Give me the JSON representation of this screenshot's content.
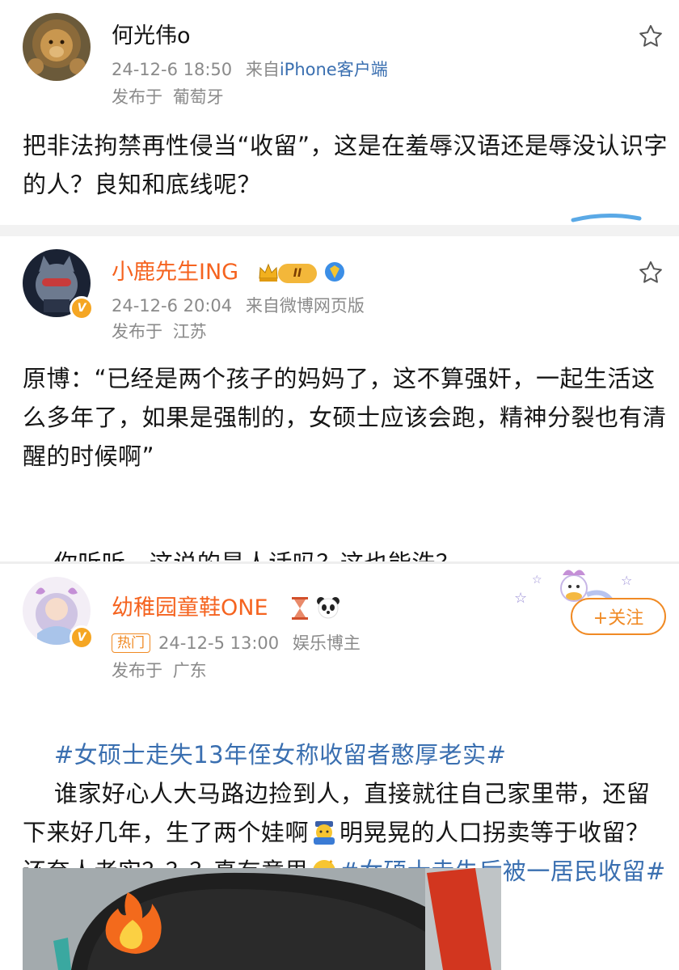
{
  "posts": [
    {
      "username": "何光伟o",
      "date": "24-12-6 18:50",
      "source_prefix": "来自",
      "source": "iPhone客户端",
      "location_label": "发布于",
      "location": "葡萄牙",
      "text": "把非法拘禁再性侵当“收留”，这是在羞辱汉语还是辱没认识字的人？良知和底线呢？"
    },
    {
      "username": "小鹿先生ING",
      "member_level": "II",
      "date": "24-12-6 20:04",
      "source_prefix": "来自",
      "source": "微博网页版",
      "location_label": "发布于",
      "location": "江苏",
      "text_line1": "原博：“已经是两个孩子的妈妈了，这不算强奸，一起生活这么多年了，如果是强制的，女硕士应该会跑，精神分裂也有清醒的时候啊”",
      "text_line2": "你听听，这说的是人话吗？这也能洗？"
    },
    {
      "username": "幼稚园童鞋ONE",
      "hot_tag": "热门",
      "date": "24-12-5 13:00",
      "role": "娱乐博主",
      "location_label": "发布于",
      "location": "广东",
      "follow_label": "+关注",
      "hashtag1": "#女硕士走失13年侄女称收留者憨厚老实#",
      "text_a": "谁家好心人大马路边捡到人，直接就往自己家里带，还留下来好几年，生了两个娃啊",
      "text_b": "明晃晃的人口拐卖等于收留？还夸人老实？？？真有意思",
      "hashtag2": "#女硕士走失后被一居民收留#"
    }
  ],
  "badge_letter": "V",
  "colors": {
    "accent_orange": "#f5631f",
    "link_blue": "#3a6fb0",
    "meta_gray": "#8a8a8a"
  }
}
